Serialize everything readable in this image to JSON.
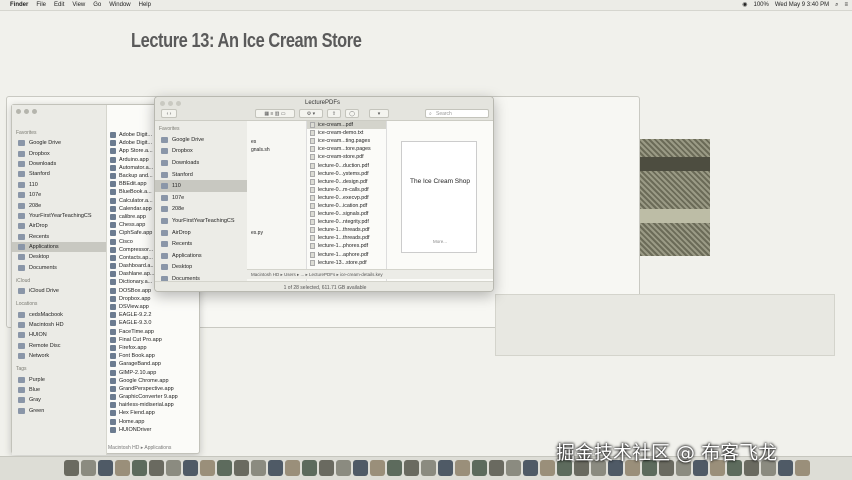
{
  "menubar": {
    "app": "Finder",
    "items": [
      "File",
      "Edit",
      "View",
      "Go",
      "Window",
      "Help"
    ],
    "battery": "100%",
    "clock": "Wed May 9  3:40 PM"
  },
  "slide": {
    "title": "Lecture 13: An Ice Cream Store"
  },
  "big_finder": {
    "favorites_header": "Favorites",
    "favorites": [
      "Google Drive",
      "Dropbox",
      "Downloads",
      "Stanford",
      "110",
      "107e",
      "208e",
      "YourFirstYearTeachingCS",
      "AirDrop",
      "Recents",
      "Applications",
      "Desktop",
      "Documents"
    ],
    "icloud_header": "iCloud",
    "icloud": [
      "iCloud Drive"
    ],
    "locations_header": "Locations",
    "locations": [
      "cedsMacbook",
      "Macintosh HD",
      "HUION",
      "Remote Disc",
      "Network"
    ],
    "tags_header": "Tags",
    "tags": [
      "Purple",
      "Blue",
      "Gray",
      "Green"
    ],
    "apps": [
      "Adobe Digit...",
      "Adobe Digit...",
      "App Store.a...",
      "Arduino.app",
      "Automator.a...",
      "Backup and...",
      "BBEdit.app",
      "BlueBook.a...",
      "Calculator.a...",
      "Calendar.app",
      "calibre.app",
      "Chess.app",
      "CiphSafe.app",
      "Cisco",
      "Compressor...",
      "Contacts.ap...",
      "Dashboard.a...",
      "Dashlane.ap...",
      "Dictionary.a...",
      "DOSBox.app",
      "Dropbox.app",
      "DSView.app",
      "EAGLE-9.2.2",
      "EAGLE-9.3.0",
      "FaceTime.app",
      "Final Cut Pro.app",
      "Firefox.app",
      "Font Book.app",
      "GarageBand.app",
      "GIMP-2.10.app",
      "Google Chrome.app",
      "GrandPerspective.app",
      "GraphicConverter 9.app",
      "hairless-midiserial.app",
      "Hex Fiend.app",
      "Home.app",
      "HUIONDriver"
    ],
    "footer": "Macintosh HD  ▸  Applications"
  },
  "front_finder": {
    "title": "LecturePDFs",
    "search_placeholder": "Search",
    "favorites_header": "Favorites",
    "favorites": [
      "Google Drive",
      "Dropbox",
      "Downloads",
      "Stanford",
      "110",
      "107e",
      "208e",
      "YourFirstYearTeachingCS",
      "AirDrop",
      "Recents",
      "Applications",
      "Desktop",
      "Documents"
    ],
    "mid_column": [
      "",
      "",
      "es",
      "gnals.sh",
      "",
      "",
      "",
      "",
      "",
      "",
      "",
      "",
      "",
      "es.py"
    ],
    "files": [
      "ice-cream...pdf",
      "ice-cream-demo.txt",
      "ice-cream...ting.pages",
      "ice-cream...tore.pages",
      "ice-cream-store.pdf",
      "lecture-0...duction.pdf",
      "lecture-0...ystems.pdf",
      "lecture-0...design.pdf",
      "lecture-0...m-calls.pdf",
      "lecture-0...execvp.pdf",
      "lecture-0...ication.pdf",
      "lecture-0...signals.pdf",
      "lecture-0...ntegrity.pdf",
      "lecture-1...threads.pdf",
      "lecture-1...threads.pdf",
      "lecture-1...phores.pdf",
      "lecture-1...aphore.pdf",
      "lecture-13...store.pdf"
    ],
    "preview_heading": "The Ice Cream Shop",
    "preview_more": "More...",
    "path": "Macintosh HD  ▸  Users  ▸  ...  ▸  LecturePDFs  ▸  ice-cream-details.key",
    "status": "1 of 28 selected, 611.71 GB available"
  },
  "watermark": "掘金技术社区 @ 布客飞龙"
}
